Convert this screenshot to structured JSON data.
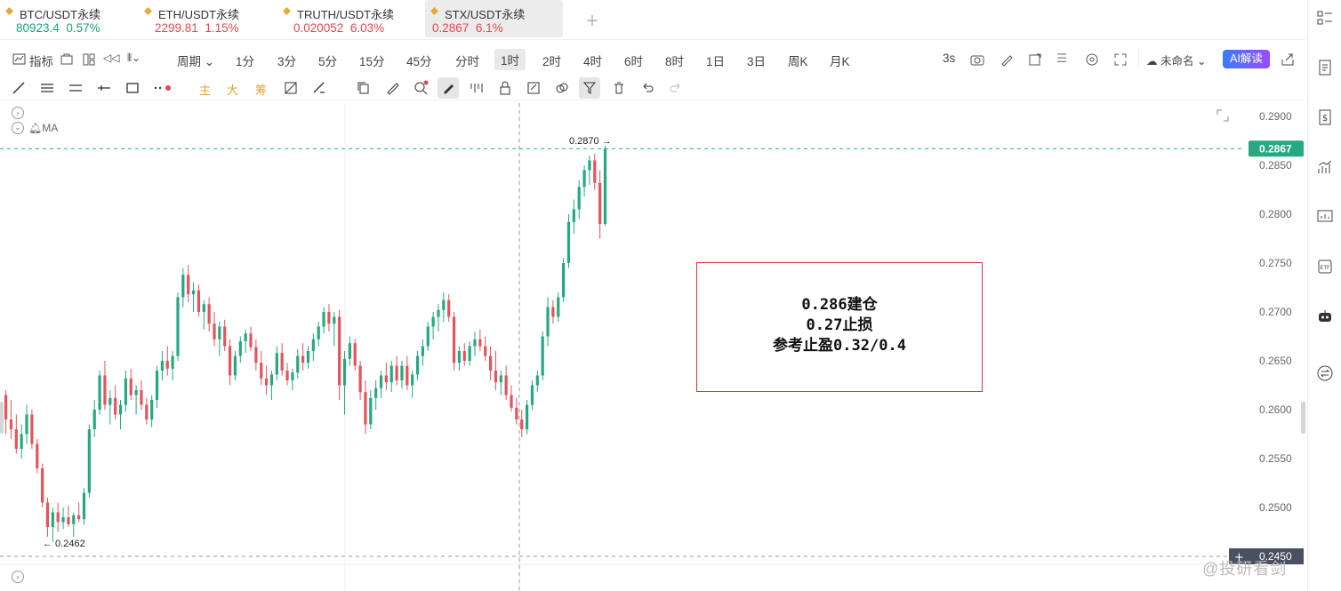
{
  "tickers": [
    {
      "name": "BTC/USDT永续",
      "price": "80923.4",
      "change": "0.57%",
      "color": "green",
      "active": false
    },
    {
      "name": "ETH/USDT永续",
      "price": "2299.81",
      "change": "1.15%",
      "color": "red",
      "active": false
    },
    {
      "name": "TRUTH/USDT永续",
      "price": "0.020052",
      "change": "6.03%",
      "color": "red",
      "active": false
    },
    {
      "name": "STX/USDT永续",
      "price": "0.2867",
      "change": "6.1%",
      "color": "red",
      "active": true
    }
  ],
  "toolbar": {
    "indicator_label": "指标",
    "period_label": "周期",
    "intervals": [
      "1分",
      "3分",
      "5分",
      "15分",
      "45分",
      "分时",
      "1时",
      "2时",
      "4时",
      "6时",
      "8时",
      "1日",
      "3日",
      "周K",
      "月K"
    ],
    "selected_interval": "1时",
    "refresh": "3s",
    "layout_name": "未命名",
    "ai_label": "AI解读"
  },
  "drawing_tools": {
    "labels": [
      "主",
      "大",
      "筹"
    ]
  },
  "chart_data": {
    "type": "candlestick",
    "ylim": [
      0.2435,
      0.2915
    ],
    "yticks": [
      "0.2900",
      "0.2850",
      "0.2800",
      "0.2750",
      "0.2700",
      "0.2650",
      "0.2600",
      "0.2550",
      "0.2500",
      "0.2450"
    ],
    "last_price": "0.2867",
    "high_label": "0.2870",
    "low_label": "0.2462",
    "indicator": "MA",
    "candles": [
      [
        0.2615,
        0.262,
        0.2575,
        0.259
      ],
      [
        0.259,
        0.261,
        0.257,
        0.258
      ],
      [
        0.258,
        0.2595,
        0.2555,
        0.256
      ],
      [
        0.256,
        0.2585,
        0.255,
        0.2575
      ],
      [
        0.2575,
        0.2605,
        0.2565,
        0.2595
      ],
      [
        0.2595,
        0.26,
        0.256,
        0.2565
      ],
      [
        0.2565,
        0.257,
        0.2535,
        0.254
      ],
      [
        0.254,
        0.2545,
        0.25,
        0.2505
      ],
      [
        0.2505,
        0.251,
        0.247,
        0.248
      ],
      [
        0.248,
        0.25,
        0.2465,
        0.2495
      ],
      [
        0.2495,
        0.2505,
        0.2475,
        0.2485
      ],
      [
        0.2485,
        0.25,
        0.2478,
        0.249
      ],
      [
        0.249,
        0.2502,
        0.248,
        0.2483
      ],
      [
        0.2483,
        0.2495,
        0.247,
        0.2492
      ],
      [
        0.2492,
        0.2505,
        0.2485,
        0.2488
      ],
      [
        0.2488,
        0.252,
        0.2482,
        0.2515
      ],
      [
        0.2515,
        0.2585,
        0.251,
        0.258
      ],
      [
        0.258,
        0.261,
        0.2572,
        0.26
      ],
      [
        0.26,
        0.264,
        0.2595,
        0.2635
      ],
      [
        0.2635,
        0.265,
        0.26,
        0.2605
      ],
      [
        0.2605,
        0.262,
        0.2585,
        0.2612
      ],
      [
        0.2612,
        0.2625,
        0.259,
        0.2595
      ],
      [
        0.2595,
        0.261,
        0.258,
        0.2605
      ],
      [
        0.2605,
        0.264,
        0.2598,
        0.2632
      ],
      [
        0.2632,
        0.2642,
        0.261,
        0.2615
      ],
      [
        0.2615,
        0.2625,
        0.2595,
        0.262
      ],
      [
        0.262,
        0.263,
        0.26,
        0.2605
      ],
      [
        0.2605,
        0.2612,
        0.2585,
        0.259
      ],
      [
        0.259,
        0.2615,
        0.2582,
        0.261
      ],
      [
        0.261,
        0.2645,
        0.2602,
        0.264
      ],
      [
        0.264,
        0.266,
        0.263,
        0.265
      ],
      [
        0.265,
        0.2665,
        0.2635,
        0.2642
      ],
      [
        0.2642,
        0.266,
        0.263,
        0.2655
      ],
      [
        0.2655,
        0.272,
        0.265,
        0.2715
      ],
      [
        0.2715,
        0.2745,
        0.2705,
        0.2738
      ],
      [
        0.2738,
        0.2748,
        0.271,
        0.2718
      ],
      [
        0.2718,
        0.273,
        0.27,
        0.2722
      ],
      [
        0.2722,
        0.2728,
        0.2695,
        0.27
      ],
      [
        0.27,
        0.2712,
        0.2682,
        0.2708
      ],
      [
        0.2708,
        0.2715,
        0.268,
        0.2688
      ],
      [
        0.2688,
        0.27,
        0.2665,
        0.2672
      ],
      [
        0.2672,
        0.269,
        0.2655,
        0.2685
      ],
      [
        0.2685,
        0.2692,
        0.266,
        0.2665
      ],
      [
        0.2665,
        0.2672,
        0.2625,
        0.2635
      ],
      [
        0.2635,
        0.266,
        0.263,
        0.2655
      ],
      [
        0.2655,
        0.2675,
        0.2648,
        0.267
      ],
      [
        0.267,
        0.2682,
        0.2658,
        0.2678
      ],
      [
        0.2678,
        0.2685,
        0.266,
        0.2664
      ],
      [
        0.2664,
        0.2672,
        0.264,
        0.2648
      ],
      [
        0.2648,
        0.266,
        0.2625,
        0.2632
      ],
      [
        0.2632,
        0.2645,
        0.2615,
        0.2625
      ],
      [
        0.2625,
        0.264,
        0.261,
        0.2636
      ],
      [
        0.2636,
        0.2665,
        0.263,
        0.2658
      ],
      [
        0.2658,
        0.2668,
        0.2635,
        0.264
      ],
      [
        0.264,
        0.2648,
        0.2625,
        0.263
      ],
      [
        0.263,
        0.2642,
        0.262,
        0.2638
      ],
      [
        0.2638,
        0.2662,
        0.2632,
        0.2655
      ],
      [
        0.2655,
        0.2668,
        0.264,
        0.2648
      ],
      [
        0.2648,
        0.2665,
        0.2642,
        0.266
      ],
      [
        0.266,
        0.2678,
        0.265,
        0.2672
      ],
      [
        0.2672,
        0.269,
        0.2665,
        0.2685
      ],
      [
        0.2685,
        0.2705,
        0.2678,
        0.27
      ],
      [
        0.27,
        0.2708,
        0.268,
        0.2688
      ],
      [
        0.2688,
        0.27,
        0.2665,
        0.2695
      ],
      [
        0.2695,
        0.2702,
        0.261,
        0.2625
      ],
      [
        0.2625,
        0.266,
        0.2595,
        0.2652
      ],
      [
        0.2652,
        0.2675,
        0.2645,
        0.2668
      ],
      [
        0.2668,
        0.2672,
        0.264,
        0.2645
      ],
      [
        0.2645,
        0.265,
        0.261,
        0.2618
      ],
      [
        0.2618,
        0.263,
        0.2575,
        0.2585
      ],
      [
        0.2585,
        0.262,
        0.258,
        0.2612
      ],
      [
        0.2612,
        0.263,
        0.26,
        0.2622
      ],
      [
        0.2622,
        0.264,
        0.2612,
        0.2635
      ],
      [
        0.2635,
        0.2648,
        0.262,
        0.2628
      ],
      [
        0.2628,
        0.265,
        0.2618,
        0.2645
      ],
      [
        0.2645,
        0.2655,
        0.2625,
        0.263
      ],
      [
        0.263,
        0.265,
        0.2622,
        0.2645
      ],
      [
        0.2645,
        0.2655,
        0.262,
        0.2625
      ],
      [
        0.2625,
        0.264,
        0.2612,
        0.2636
      ],
      [
        0.2636,
        0.266,
        0.263,
        0.2655
      ],
      [
        0.2655,
        0.2672,
        0.2645,
        0.2665
      ],
      [
        0.2665,
        0.269,
        0.266,
        0.2685
      ],
      [
        0.2685,
        0.27,
        0.2672,
        0.2695
      ],
      [
        0.2695,
        0.2708,
        0.268,
        0.2702
      ],
      [
        0.2702,
        0.272,
        0.269,
        0.2712
      ],
      [
        0.2712,
        0.2718,
        0.269,
        0.2695
      ],
      [
        0.2695,
        0.27,
        0.264,
        0.2648
      ],
      [
        0.2648,
        0.2665,
        0.264,
        0.266
      ],
      [
        0.266,
        0.2668,
        0.2645,
        0.265
      ],
      [
        0.265,
        0.267,
        0.2645,
        0.2665
      ],
      [
        0.2665,
        0.268,
        0.2655,
        0.2672
      ],
      [
        0.2672,
        0.2682,
        0.266,
        0.2665
      ],
      [
        0.2665,
        0.2675,
        0.265,
        0.2655
      ],
      [
        0.2655,
        0.2665,
        0.263,
        0.264
      ],
      [
        0.264,
        0.266,
        0.262,
        0.2628
      ],
      [
        0.2628,
        0.264,
        0.2615,
        0.2635
      ],
      [
        0.2635,
        0.2645,
        0.261,
        0.2615
      ],
      [
        0.2615,
        0.2625,
        0.2598,
        0.2602
      ],
      [
        0.2602,
        0.2612,
        0.2585,
        0.259
      ],
      [
        0.259,
        0.26,
        0.2572,
        0.258
      ],
      [
        0.258,
        0.261,
        0.2575,
        0.2605
      ],
      [
        0.2605,
        0.263,
        0.26,
        0.2625
      ],
      [
        0.2625,
        0.264,
        0.2618,
        0.2635
      ],
      [
        0.2635,
        0.268,
        0.263,
        0.2675
      ],
      [
        0.2675,
        0.2715,
        0.2665,
        0.2705
      ],
      [
        0.2705,
        0.2712,
        0.2688,
        0.2695
      ],
      [
        0.2695,
        0.272,
        0.269,
        0.2715
      ],
      [
        0.2715,
        0.2755,
        0.271,
        0.275
      ],
      [
        0.275,
        0.28,
        0.2745,
        0.2792
      ],
      [
        0.2792,
        0.2815,
        0.278,
        0.2805
      ],
      [
        0.2805,
        0.2835,
        0.2795,
        0.2828
      ],
      [
        0.2828,
        0.285,
        0.2818,
        0.2845
      ],
      [
        0.2845,
        0.286,
        0.283,
        0.2855
      ],
      [
        0.2855,
        0.2862,
        0.2825,
        0.2832
      ],
      [
        0.2832,
        0.2845,
        0.2775,
        0.279
      ],
      [
        0.279,
        0.287,
        0.2788,
        0.2867
      ]
    ]
  },
  "annotation": {
    "lines": [
      "0.286建仓",
      "0.27止损",
      "参考止盈0.32/0.4"
    ]
  },
  "watermark": "@投研看剑",
  "colors": {
    "up": "#26a882",
    "down": "#e3545c",
    "accent": "#1aa37a"
  }
}
